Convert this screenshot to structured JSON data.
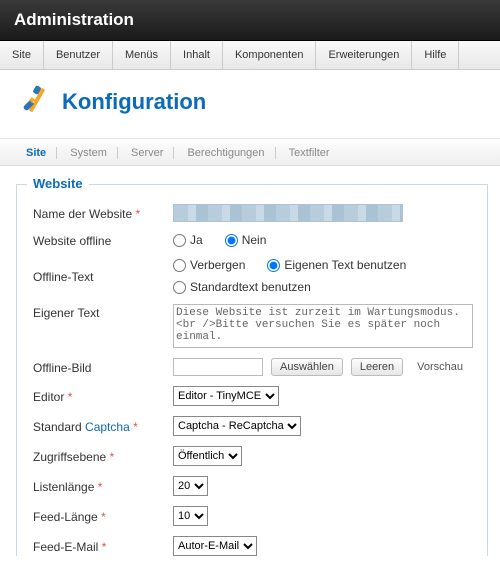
{
  "header": {
    "title": "Administration"
  },
  "menu": [
    "Site",
    "Benutzer",
    "Menüs",
    "Inhalt",
    "Komponenten",
    "Erweiterungen",
    "Hilfe"
  ],
  "page": {
    "title": "Konfiguration"
  },
  "subtabs": [
    "Site",
    "System",
    "Server",
    "Berechtigungen",
    "Textfilter"
  ],
  "subtab_active": 0,
  "fieldset_legend": "Website",
  "labels": {
    "site_name": "Name der Website",
    "site_offline": "Website offline",
    "offline_text_mode": "Offline-Text",
    "custom_text": "Eigener Text",
    "offline_image": "Offline-Bild",
    "editor": "Editor",
    "captcha_prefix": "Standard ",
    "captcha_link": "Captcha",
    "access": "Zugriffsebene",
    "list_len": "Listenlänge",
    "feed_len": "Feed-Länge",
    "feed_email": "Feed-E-Mail"
  },
  "options": {
    "yes": "Ja",
    "no": "Nein",
    "hide": "Verbergen",
    "custom": "Eigenen Text benutzen",
    "default": "Standardtext benutzen",
    "select_btn": "Auswählen",
    "clear_btn": "Leeren",
    "preview": "Vorschau"
  },
  "values": {
    "site_offline": "no",
    "offline_text_mode": "custom",
    "custom_text": "Diese Website ist zurzeit im Wartungsmodus.<br />Bitte versuchen Sie es später noch einmal.",
    "editor": "Editor - TinyMCE",
    "captcha": "Captcha - ReCaptcha",
    "access": "Öffentlich",
    "list_len": "20",
    "feed_len": "10",
    "feed_email": "Autor-E-Mail"
  }
}
